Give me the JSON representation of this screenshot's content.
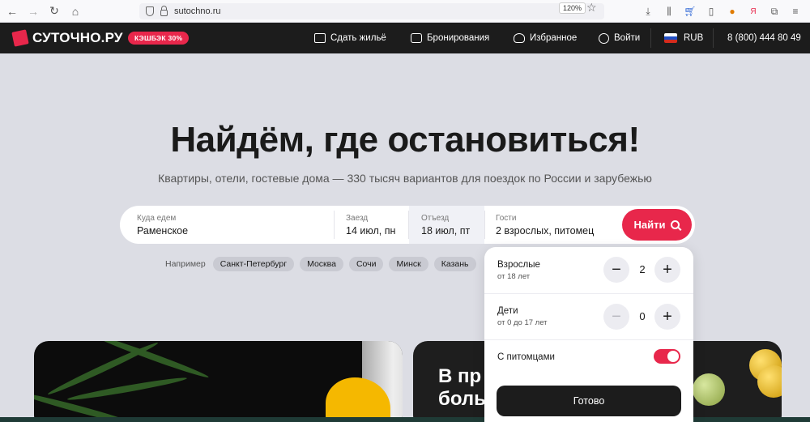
{
  "browser": {
    "url": "sutochno.ru",
    "zoom": "120%"
  },
  "header": {
    "logo_text": "СУТОЧНО.РУ",
    "cashback_badge": "КЭШБЭК 30%",
    "nav": {
      "rent_out": "Сдать жильё",
      "bookings": "Бронирования",
      "favorites": "Избранное",
      "login": "Войти",
      "currency": "RUB",
      "phone": "8 (800) 444 80 49"
    }
  },
  "hero": {
    "title": "Найдём, где остановиться!",
    "subtitle": "Квартиры, отели, гостевые дома — 330 тысяч вариантов для поездок по России и зарубежью"
  },
  "search": {
    "destination_label": "Куда едем",
    "destination_value": "Раменское",
    "checkin_label": "Заезд",
    "checkin_value": "14 июл, пн",
    "checkout_label": "Отъезд",
    "checkout_value": "18 июл, пт",
    "guests_label": "Гости",
    "guests_value": "2 взрослых, питомец",
    "find_label": "Найти"
  },
  "examples": {
    "label": "Например",
    "cities": [
      "Санкт-Петербург",
      "Москва",
      "Сочи",
      "Минск",
      "Казань"
    ]
  },
  "guests_dropdown": {
    "adults_title": "Взрослые",
    "adults_sub": "от 18 лет",
    "adults_count": "2",
    "children_title": "Дети",
    "children_sub": "от 0 до 17 лет",
    "children_count": "0",
    "pets_label": "С питомцами",
    "pets_enabled": true,
    "done_label": "Готово",
    "minus": "−",
    "plus": "+"
  },
  "promo": {
    "right_text_line1": "В пр",
    "right_text_line2": "боль"
  },
  "colors": {
    "accent": "#e8274b",
    "header_bg": "#1c1c1c",
    "page_bg": "#dcdde4"
  }
}
